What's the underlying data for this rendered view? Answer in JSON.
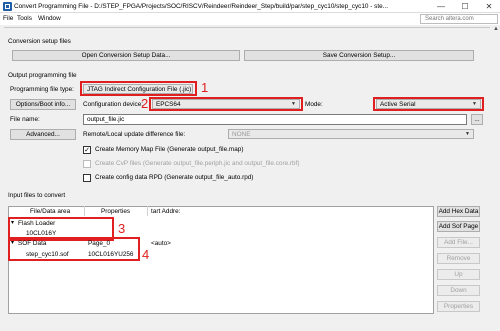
{
  "window": {
    "title": "Convert Programming File - D:/STEP_FPGA/Projects/SOC/RISCV/Reindeer/Reindeer_Step/build/par/step_cyc10/step_cyc10 - ste...",
    "minimize": "—",
    "maximize": "☐",
    "close": "✕"
  },
  "menu": {
    "file": "File",
    "tools": "Tools",
    "window": "Window",
    "search_placeholder": "Search altera.com"
  },
  "conversion_setup": {
    "label": "Conversion setup files",
    "open_btn": "Open Conversion Setup Data...",
    "save_btn": "Save Conversion Setup..."
  },
  "output": {
    "label": "Output programming file",
    "file_type_label": "Programming file type:",
    "file_type_value": "JTAG Indirect Configuration File (.jic)",
    "options_btn": "Options/Boot info...",
    "config_device_label": "Configuration device:",
    "config_device_value": "EPCS64",
    "mode_label": "Mode:",
    "mode_value": "Active Serial",
    "file_name_label": "File name:",
    "file_name_value": "output_file.jic",
    "browse_btn": "...",
    "advanced_btn": "Advanced...",
    "remote_label": "Remote/Local update difference file:",
    "remote_value": "NONE",
    "chk_memory_map": "Create Memory Map File (Generate output_file.map)",
    "chk_cvp": "Create CvP files (Generate output_file.periph.jic and output_file.core.rbf)",
    "chk_rpd": "Create config data RPD (Generate output_file_auto.rpd)"
  },
  "input": {
    "label": "Input files to convert",
    "columns": [
      "File/Data area",
      "Properties",
      "tart Addre:"
    ],
    "flash_loader": "Flash Loader",
    "flash_device": "10CL016Y",
    "sof_data": "SOF Data",
    "sof_page": "Page_0",
    "sof_addr": "<auto>",
    "sof_file": "step_cyc10.sof",
    "sof_device": "10CL016YU256",
    "toggle": "▾"
  },
  "side_buttons": {
    "add_hex": "Add Hex Data",
    "add_sof": "Add Sof Page",
    "add_file": "Add File...",
    "remove": "Remove",
    "up": "Up",
    "down": "Down",
    "properties": "Properties"
  },
  "annotations": {
    "n1": "1",
    "n2": "2",
    "n3": "3",
    "n4": "4"
  },
  "colors": {
    "annotation_red": "#e02020",
    "titlebar_bg": "#ffffff",
    "dialog_bg": "#f0f0f0"
  }
}
